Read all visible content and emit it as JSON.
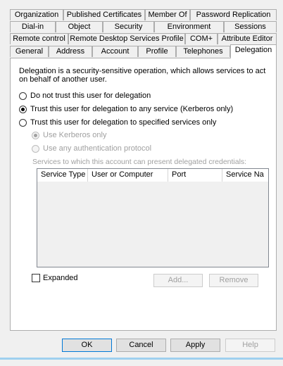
{
  "tabs": {
    "row1": [
      "Organization",
      "Published Certificates",
      "Member Of",
      "Password Replication"
    ],
    "row2": [
      "Dial-in",
      "Object",
      "Security",
      "Environment",
      "Sessions"
    ],
    "row3": [
      "Remote control",
      "Remote Desktop Services Profile",
      "COM+",
      "Attribute Editor"
    ],
    "row4": [
      "General",
      "Address",
      "Account",
      "Profile",
      "Telephones",
      "Delegation"
    ]
  },
  "delegation": {
    "description": "Delegation is a security-sensitive operation, which allows services to act on behalf of another user.",
    "option_none": "Do not trust this user for delegation",
    "option_any": "Trust this user for delegation to any service (Kerberos only)",
    "option_specified": "Trust this user for delegation to specified services only",
    "sub_kerberos": "Use Kerberos only",
    "sub_any_protocol": "Use any authentication protocol",
    "services_label": "Services to which this account can present delegated credentials:",
    "columns": [
      "Service Type",
      "User or Computer",
      "Port",
      "Service Na"
    ],
    "expanded_label": "Expanded",
    "add_button": "Add...",
    "remove_button": "Remove"
  },
  "footer": {
    "ok": "OK",
    "cancel": "Cancel",
    "apply": "Apply",
    "help": "Help"
  },
  "colors": {
    "accent_bar": "#9fd0ef",
    "default_button_border": "#0078d7"
  }
}
